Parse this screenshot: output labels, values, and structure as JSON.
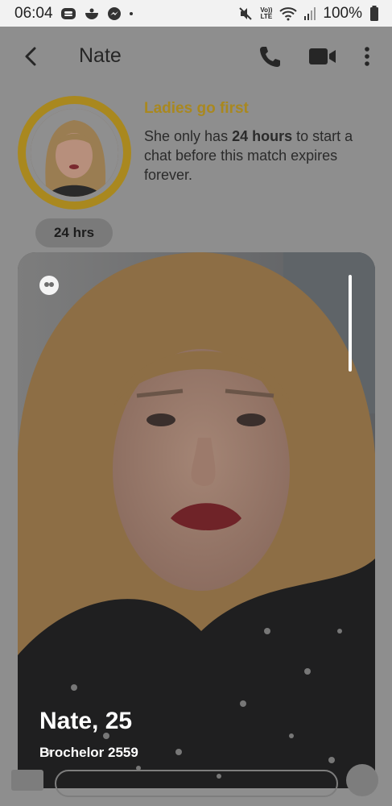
{
  "status_bar": {
    "time": "06:04",
    "volte": "Vo))",
    "lte": "LTE",
    "battery_percent": "100%"
  },
  "header": {
    "title": "Nate"
  },
  "match_banner": {
    "title": "Ladies go first",
    "text_before": "She only has ",
    "text_bold": "24 hours",
    "text_after": " to start a chat before this match expires forever.",
    "timer_label": "24 hrs"
  },
  "profile_card": {
    "name_age": "Nate, 25",
    "subtitle": "Brochelor 2559",
    "photo_progress_fraction": 1.0
  },
  "colors": {
    "accent_gold": "#a9881f",
    "dim_background": "#8e8e8e"
  },
  "icons": {
    "back": "chevron-left-icon",
    "call": "phone-icon",
    "video": "video-camera-icon",
    "more": "more-vertical-icon",
    "quote": "quote-icon"
  }
}
